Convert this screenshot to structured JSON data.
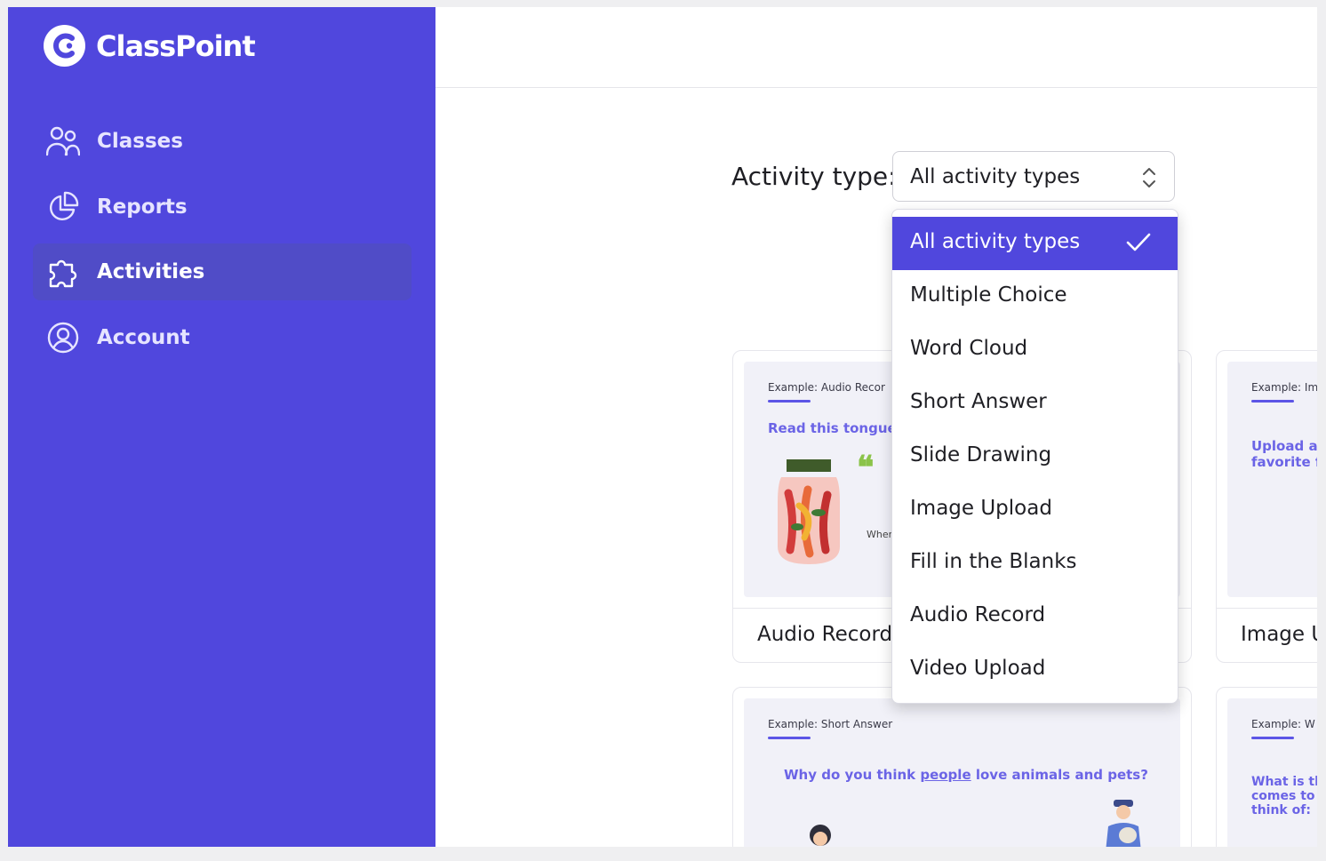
{
  "app": {
    "name": "ClassPoint"
  },
  "sidebar": {
    "items": [
      {
        "label": "Classes",
        "icon": "users-icon",
        "active": false
      },
      {
        "label": "Reports",
        "icon": "pie-chart-icon",
        "active": false
      },
      {
        "label": "Activities",
        "icon": "puzzle-icon",
        "active": true
      },
      {
        "label": "Account",
        "icon": "user-circle-icon",
        "active": false
      }
    ]
  },
  "filter": {
    "label": "Activity type:",
    "selected": "All activity types",
    "options": [
      "All activity types",
      "Multiple Choice",
      "Word Cloud",
      "Short Answer",
      "Slide Drawing",
      "Image Upload",
      "Fill in the Blanks",
      "Audio Record",
      "Video Upload"
    ]
  },
  "cards": [
    {
      "example": "Example: Audio Recor",
      "question": "Read this tongue",
      "fragment": "Wher",
      "title": "Audio Record"
    },
    {
      "example": "Example: Im",
      "question_lines": [
        "Upload a",
        "favorite f"
      ],
      "title": "Image U"
    },
    {
      "example": "Example: Short Answer",
      "question_pre": "Why do you think ",
      "question_link": "people",
      "question_post": " love animals and pets?"
    },
    {
      "example": "Example: W",
      "question_lines": [
        "What is th",
        "comes to",
        "think of:"
      ]
    }
  ],
  "colors": {
    "brand": "#5047dd",
    "accent": "#6b64e6",
    "quote": "#8bc34a"
  }
}
